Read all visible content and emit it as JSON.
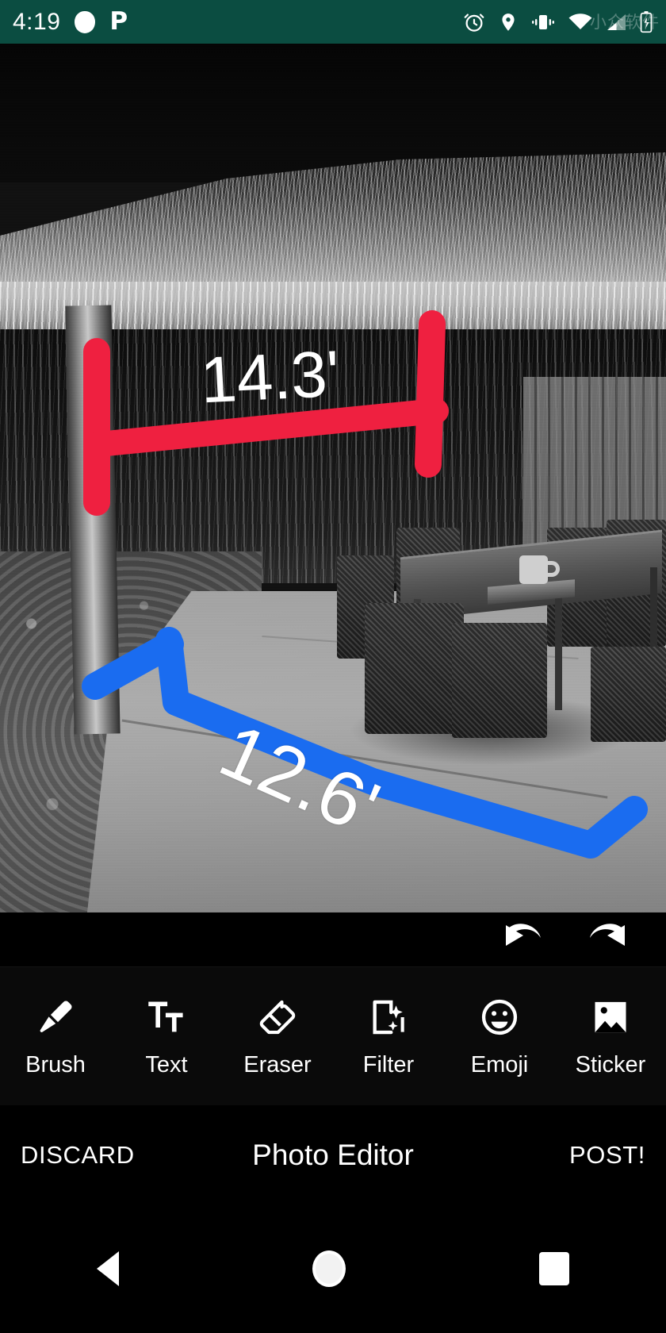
{
  "status_bar": {
    "time": "4:19",
    "background_color": "#0b4d41",
    "left_icons": [
      {
        "name": "circle-indicator-icon"
      },
      {
        "name": "parking-p-icon",
        "glyph": "P"
      }
    ],
    "right_icons": [
      {
        "name": "alarm-clock-icon"
      },
      {
        "name": "location-pin-icon"
      },
      {
        "name": "vibrate-icon"
      },
      {
        "name": "wifi-icon"
      },
      {
        "name": "cell-signal-icon"
      },
      {
        "name": "battery-charging-icon"
      }
    ],
    "watermark": "小众软件"
  },
  "canvas": {
    "annotations": [
      {
        "name": "red-dimension-annotation",
        "label": "14.3'",
        "color": "#ef2040",
        "shape": "dimension-line-with-end-caps"
      },
      {
        "name": "blue-arrow-annotation",
        "label": "12.6'",
        "color": "#1a6cf0",
        "shape": "arrow-polyline"
      }
    ]
  },
  "history": {
    "undo_label": "undo-arrow-icon",
    "redo_label": "redo-arrow-icon"
  },
  "tools": [
    {
      "label": "Brush",
      "icon": "brush-icon"
    },
    {
      "label": "Text",
      "icon": "text-icon"
    },
    {
      "label": "Eraser",
      "icon": "eraser-icon"
    },
    {
      "label": "Filter",
      "icon": "filter-icon"
    },
    {
      "label": "Emoji",
      "icon": "emoji-icon"
    },
    {
      "label": "Sticker",
      "icon": "sticker-icon"
    }
  ],
  "action_bar": {
    "discard_label": "DISCARD",
    "title": "Photo Editor",
    "post_label": "POST!"
  },
  "nav_bar": {
    "back": "back-triangle-icon",
    "home": "home-circle-icon",
    "recents": "recents-square-icon"
  }
}
